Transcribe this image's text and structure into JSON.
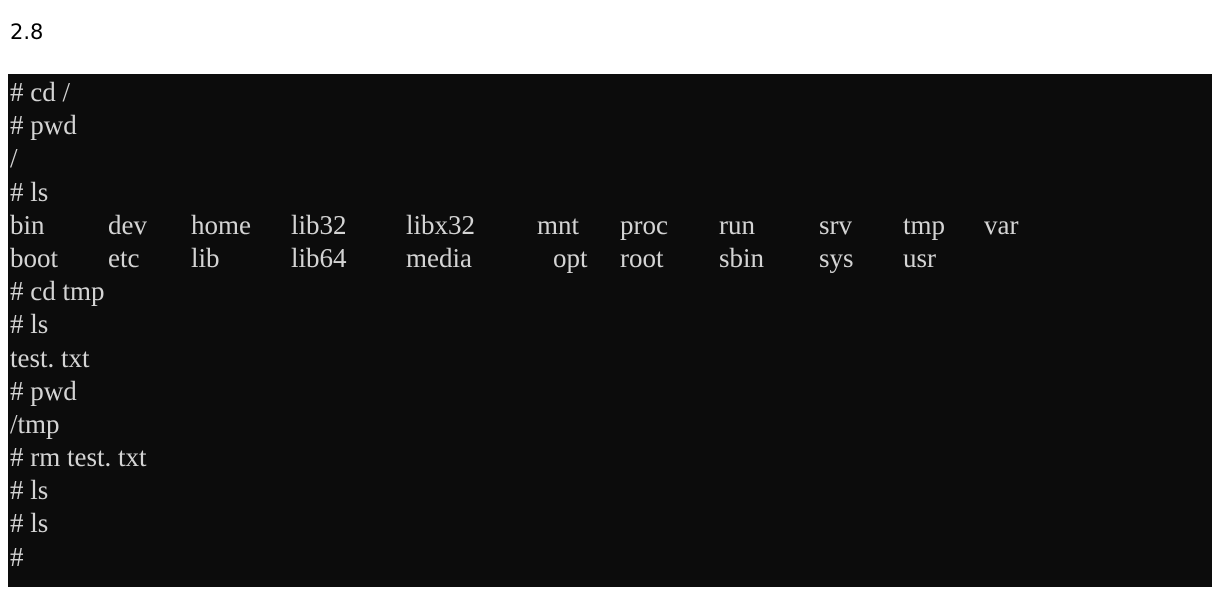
{
  "label": "2.8",
  "terminal": {
    "lines": [
      "# cd /",
      "# pwd",
      "/",
      "# ls",
      "",
      "",
      "# cd tmp",
      "# ls",
      "test. txt",
      "# pwd",
      "/tmp",
      "# rm test. txt",
      "# ls",
      "# ls",
      "#"
    ],
    "ls_row1": [
      "bin",
      "dev",
      "home",
      "lib32",
      "libx32",
      "mnt",
      "proc",
      "run",
      "srv",
      "tmp",
      "var"
    ],
    "ls_row2": [
      "boot",
      "etc",
      "lib",
      "lib64",
      "media",
      "opt",
      "root",
      "sbin",
      "sys",
      "usr"
    ]
  }
}
